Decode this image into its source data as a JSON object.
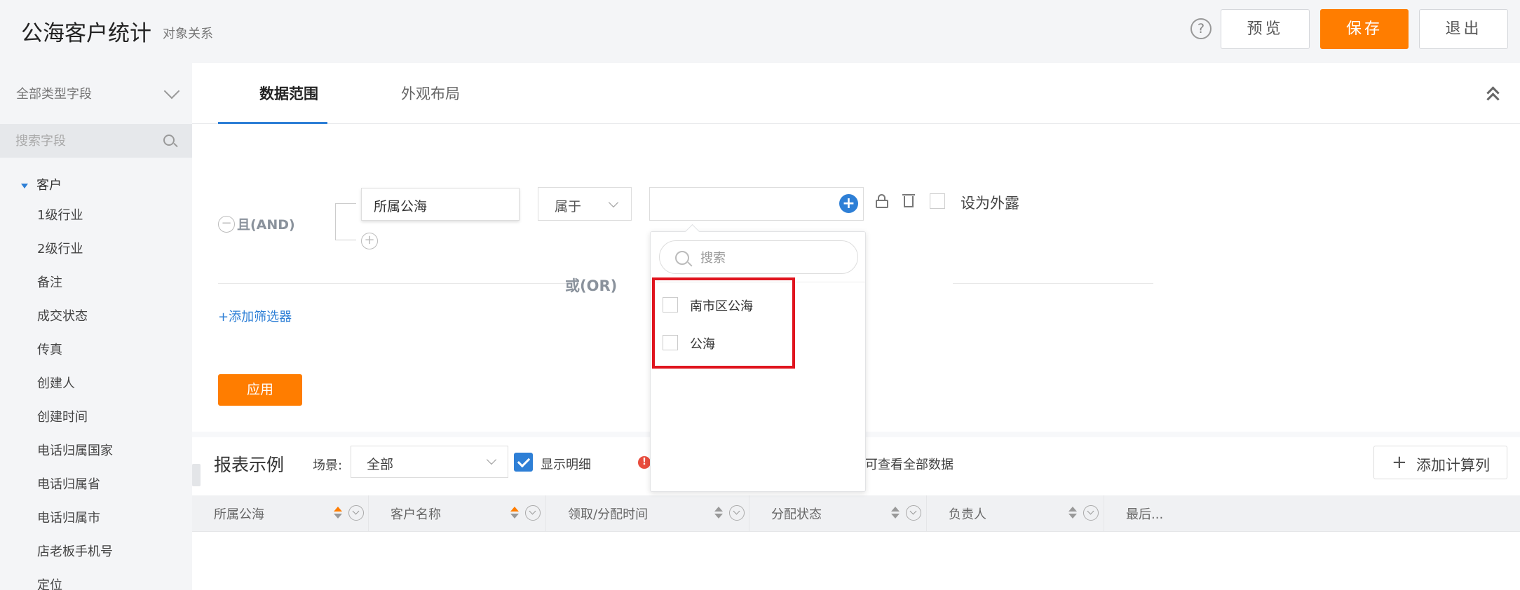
{
  "header": {
    "title": "公海客户统计",
    "subtitle": "对象关系",
    "help_glyph": "?",
    "preview_label": "预览",
    "save_label": "保存",
    "exit_label": "退出"
  },
  "sidebar": {
    "type_select": "全部类型字段",
    "search_placeholder": "搜索字段",
    "root": "客户",
    "fields": [
      "1级行业",
      "2级行业",
      "备注",
      "成交状态",
      "传真",
      "创建人",
      "创建时间",
      "电话归属国家",
      "电话归属省",
      "电话归属市",
      "店老板手机号",
      "定位"
    ]
  },
  "tabs": {
    "data_range": "数据范围",
    "appearance": "外观布局"
  },
  "filter": {
    "and_label": "且(AND)",
    "minus_glyph": "−",
    "plus_glyph": "+",
    "field": "所属公海",
    "operator": "属于",
    "value_add_glyph": "+",
    "set_exposed": "设为外露",
    "or_label": "或(OR)",
    "add_filter": "+添加筛选器",
    "apply": "应用"
  },
  "dropdown": {
    "search_placeholder": "搜索",
    "options": [
      "南市区公海",
      "公海"
    ]
  },
  "report": {
    "title": "报表示例",
    "scene_label": "场景:",
    "scene_value": "全部",
    "show_detail": "显示明细",
    "warn_glyph": "!",
    "warning_text": "可查看全部数据",
    "add_calc_column": "添加计算列",
    "columns": [
      "所属公海",
      "客户名称",
      "领取/分配时间",
      "分配状态",
      "负责人",
      "最后..."
    ]
  },
  "colors": {
    "accent": "#ff7d00",
    "primary": "#2e7fd6",
    "highlight": "#e0141e"
  }
}
